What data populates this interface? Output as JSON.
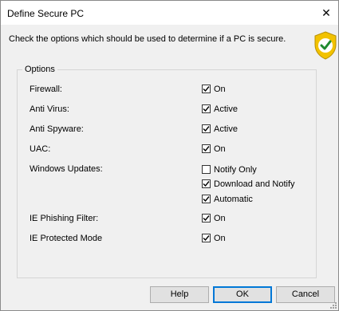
{
  "window": {
    "title": "Define Secure PC",
    "close_glyph": "✕"
  },
  "instruction": "Check the options which should be used to determine if a PC is secure.",
  "icon": {
    "name": "shield-check-icon",
    "color": "#f2c200",
    "check_color": "#1f8a2e"
  },
  "options": {
    "legend": "Options",
    "firewall": {
      "label": "Firewall:",
      "checkbox": {
        "text": "On",
        "checked": true
      }
    },
    "antivirus": {
      "label": "Anti Virus:",
      "checkbox": {
        "text": "Active",
        "checked": true
      }
    },
    "antispyware": {
      "label": "Anti Spyware:",
      "checkbox": {
        "text": "Active",
        "checked": true
      }
    },
    "uac": {
      "label": "UAC:",
      "checkbox": {
        "text": "On",
        "checked": true
      }
    },
    "updates": {
      "label": "Windows Updates:",
      "notify_only": {
        "text": "Notify Only",
        "checked": false
      },
      "download_notify": {
        "text": "Download and Notify",
        "checked": true
      },
      "automatic": {
        "text": "Automatic",
        "checked": true
      }
    },
    "phishing": {
      "label": "IE Phishing Filter:",
      "checkbox": {
        "text": "On",
        "checked": true
      }
    },
    "protected": {
      "label": "IE Protected Mode",
      "checkbox": {
        "text": "On",
        "checked": true
      }
    }
  },
  "buttons": {
    "help": "Help",
    "ok": "OK",
    "cancel": "Cancel"
  }
}
